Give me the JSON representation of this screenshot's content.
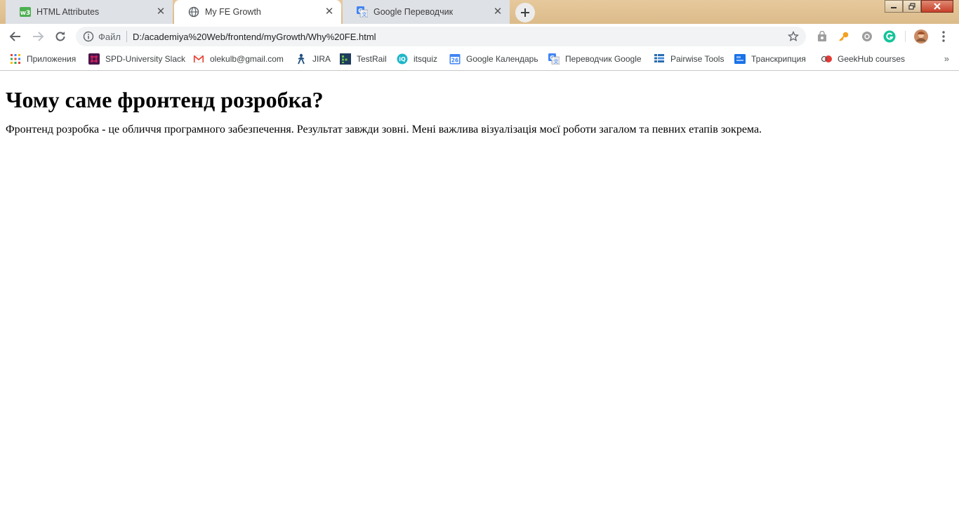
{
  "tabs": [
    {
      "title": "HTML Attributes",
      "icon": "w3schools-icon",
      "active": false
    },
    {
      "title": "My FE Growth",
      "icon": "globe-icon",
      "active": true
    },
    {
      "title": "Google Переводчик",
      "icon": "google-translate-icon",
      "active": false
    }
  ],
  "address_bar": {
    "scheme_label": "Файл",
    "url": "D:/academiya%20Web/frontend/myGrowth/Why%20FE.html"
  },
  "bookmarks": [
    {
      "label": "Приложения",
      "icon": "apps-grid-icon"
    },
    {
      "label": "SPD-University Slack",
      "icon": "slack-icon"
    },
    {
      "label": "olekulb@gmail.com",
      "icon": "gmail-icon"
    },
    {
      "label": "JIRA",
      "icon": "jira-icon"
    },
    {
      "label": "TestRail",
      "icon": "testrail-icon"
    },
    {
      "label": "itsquiz",
      "icon": "itsquiz-icon"
    },
    {
      "label": "Google Календарь",
      "icon": "google-calendar-icon"
    },
    {
      "label": "Переводчик Google",
      "icon": "google-translate-icon"
    },
    {
      "label": "Pairwise Tools",
      "icon": "pairwise-icon"
    },
    {
      "label": "Транскрипция",
      "icon": "transcription-icon"
    },
    {
      "label": "GeekHub courses",
      "icon": "geekhub-icon"
    }
  ],
  "calendar_icon_day": "26",
  "page": {
    "heading": "Чому саме фронтенд розробка?",
    "paragraph": "Фронтенд розробка - це обличчя програмного забезпечення. Результат завжди зовні. Мені важлива візуалізація моєї роботи загалом та певних етапів зокрема."
  },
  "colors": {
    "tab_strip": "#dcbb8a",
    "inactive_tab": "#dee1e6",
    "omnibox": "#f1f3f4",
    "grammarly": "#15c39a",
    "key_ext": "#f4a020"
  }
}
